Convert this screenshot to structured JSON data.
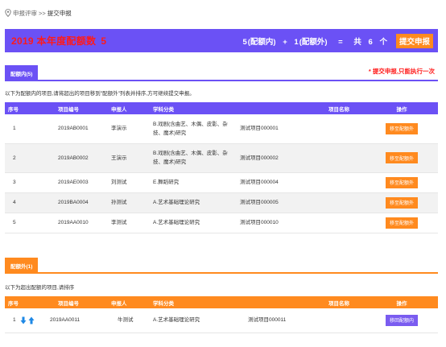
{
  "breadcrumb": {
    "parent": "申报评审",
    "separator": ">>",
    "current": "提交申报"
  },
  "quota": {
    "title": "2019 本年度配额数",
    "count": "5",
    "formula": {
      "inner_count": "5",
      "inner_label": "(配额内)",
      "plus": "+",
      "outer_count": "1",
      "outer_label": "(配额外)",
      "equals": "=",
      "total_prefix": "共",
      "total": "6",
      "total_unit": "个"
    },
    "submit_label": "提交申报"
  },
  "inner_section": {
    "tab_label": "配额内(5)",
    "note": "* 提交申报,只能执行一次",
    "hint": "以下为配额内的项目,请将超出的项目移到\"配额外\"列表并排序,方可继续提交申报。",
    "columns": [
      "序号",
      "项目编号",
      "申报人",
      "学科分类",
      "项目名称",
      "操作"
    ],
    "rows": [
      {
        "idx": "1",
        "code": "2019AB0001",
        "applicant": "李演示",
        "category": "B.戏剧(含曲艺、木偶、皮影、杂技、魔术)研究",
        "name": "测试项目000001",
        "action": "移至配额外"
      },
      {
        "idx": "2",
        "code": "2019AB0002",
        "applicant": "王演示",
        "category": "B.戏剧(含曲艺、木偶、皮影、杂技、魔术)研究",
        "name": "测试项目000002",
        "action": "移至配额外"
      },
      {
        "idx": "3",
        "code": "2019AE0003",
        "applicant": "刘测试",
        "category": "E.舞蹈研究",
        "name": "测试项目000004",
        "action": "移至配额外"
      },
      {
        "idx": "4",
        "code": "2019BA0004",
        "applicant": "孙测试",
        "category": "A.艺术基础理论研究",
        "name": "测试项目000005",
        "action": "移至配额外"
      },
      {
        "idx": "5",
        "code": "2019AA0010",
        "applicant": "李测试",
        "category": "A.艺术基础理论研究",
        "name": "测试项目000010",
        "action": "移至配额外"
      }
    ]
  },
  "outer_section": {
    "tab_label": "配额外(1)",
    "hint": "以下为超出配额的项目,请排序",
    "columns": [
      "序号",
      "项目编号",
      "申报人",
      "学科分类",
      "项目名称",
      "操作"
    ],
    "rows": [
      {
        "idx": "1",
        "code": "2019AA0011",
        "applicant": "牛测试",
        "category": "A.艺术基础理论研究",
        "name": "测试项目000011",
        "action": "移回配额内"
      }
    ]
  },
  "colors": {
    "purple": "#6b51f5",
    "orange": "#ff8a1f",
    "red": "#ff1a1a",
    "arrow_blue": "#1e88e5"
  },
  "icons": {
    "breadcrumb": "location-pin-icon",
    "move_down": "arrow-down-icon",
    "move_up": "arrow-up-icon"
  }
}
